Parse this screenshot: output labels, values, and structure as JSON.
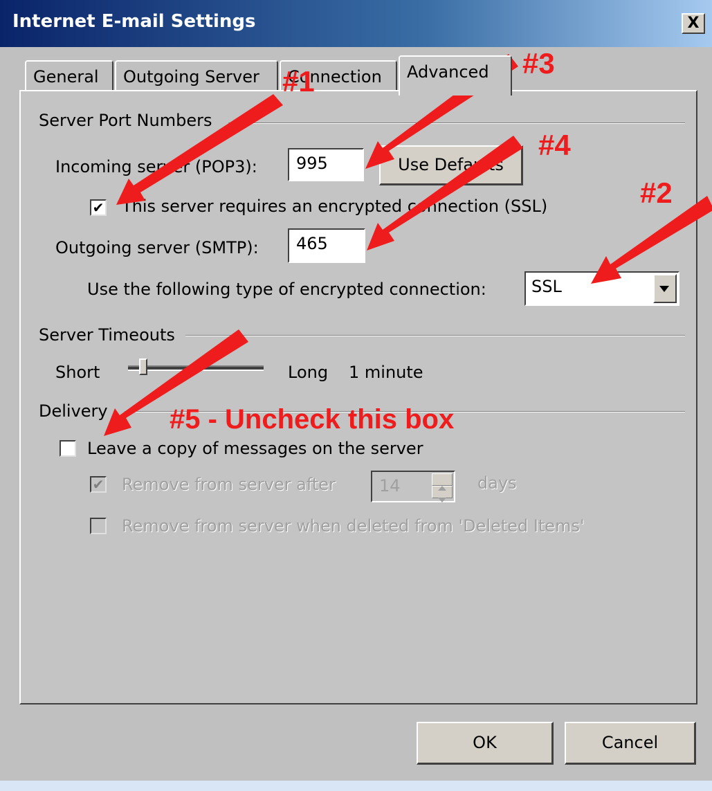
{
  "window": {
    "title": "Internet E-mail Settings",
    "close_glyph": "X"
  },
  "tabs": [
    {
      "label": "General"
    },
    {
      "label": "Outgoing Server"
    },
    {
      "label": "Connection"
    },
    {
      "label": "Advanced",
      "active": true
    }
  ],
  "port_numbers": {
    "group_label": "Server Port Numbers",
    "incoming_label": "Incoming server (POP3):",
    "incoming_value": "995",
    "use_defaults_label": "Use Defaults",
    "ssl_checkbox_label": "This server requires an encrypted connection (SSL)",
    "ssl_checked": true,
    "outgoing_label": "Outgoing server (SMTP):",
    "outgoing_value": "465",
    "encryption_label": "Use the following type of encrypted connection:",
    "encryption_value": "SSL"
  },
  "timeouts": {
    "group_label": "Server Timeouts",
    "short_label": "Short",
    "long_label": "Long",
    "value_label": "1 minute",
    "slider_level": 0.1
  },
  "delivery": {
    "group_label": "Delivery",
    "leave_copy_label": "Leave a copy of messages on the server",
    "leave_copy_checked": false,
    "remove_after_label": "Remove from server after",
    "remove_after_checked": true,
    "remove_after_value": "14",
    "days_label": "days",
    "remove_deleted_label": "Remove from server when deleted from 'Deleted Items'",
    "remove_deleted_checked": false
  },
  "footer": {
    "ok_label": "OK",
    "cancel_label": "Cancel"
  },
  "annotations": {
    "n1": "#1",
    "n2": "#2",
    "n3": "#3",
    "n4": "#4",
    "n5": "#5 - Uncheck this box",
    "color": "#ee1c1c"
  }
}
